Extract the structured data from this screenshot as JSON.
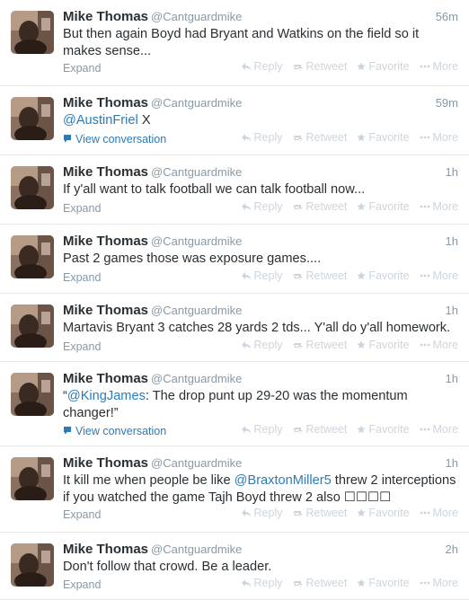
{
  "actions": {
    "reply": "Reply",
    "retweet": "Retweet",
    "favorite": "Favorite",
    "more": "More"
  },
  "colors": {
    "link": "#2b7bb9",
    "meta": "#8899a6",
    "action": "#cdd5dc"
  },
  "tweets": [
    {
      "name": "Mike Thomas",
      "handle": "@Cantguardmike",
      "time": "56m",
      "parts": [
        {
          "t": "But then again Boyd had Bryant and Watkins on the field so it makes sense..."
        }
      ],
      "footer": "Expand"
    },
    {
      "name": "Mike Thomas",
      "handle": "@Cantguardmike",
      "time": "59m",
      "parts": [
        {
          "t": "@AustinFriel",
          "m": true
        },
        {
          "t": " X"
        }
      ],
      "footer": "View conversation",
      "footer_link": true
    },
    {
      "name": "Mike Thomas",
      "handle": "@Cantguardmike",
      "time": "1h",
      "parts": [
        {
          "t": "If y'all want to talk football we can talk football now..."
        }
      ],
      "footer": "Expand"
    },
    {
      "name": "Mike Thomas",
      "handle": "@Cantguardmike",
      "time": "1h",
      "parts": [
        {
          "t": "Past 2 games those was exposure games...."
        }
      ],
      "footer": "Expand"
    },
    {
      "name": "Mike Thomas",
      "handle": "@Cantguardmike",
      "time": "1h",
      "parts": [
        {
          "t": "Martavis Bryant 3 catches 28 yards 2 tds... Y'all do y'all homework."
        }
      ],
      "footer": "Expand"
    },
    {
      "name": "Mike Thomas",
      "handle": "@Cantguardmike",
      "time": "1h",
      "parts": [
        {
          "t": "“"
        },
        {
          "t": "@KingJames",
          "m": true
        },
        {
          "t": ": The drop punt up 29-20 was the momentum changer!”"
        }
      ],
      "footer": "View conversation",
      "footer_link": true
    },
    {
      "name": "Mike Thomas",
      "handle": "@Cantguardmike",
      "time": "1h",
      "parts": [
        {
          "t": "It kill me when people be like "
        },
        {
          "t": "@BraxtonMiller5",
          "m": true
        },
        {
          "t": " threw 2 interceptions if you watched the game Tajh Boyd threw 2 also ☐☐☐☐"
        }
      ],
      "footer": "Expand"
    },
    {
      "name": "Mike Thomas",
      "handle": "@Cantguardmike",
      "time": "2h",
      "parts": [
        {
          "t": "Don't follow that crowd. Be a leader."
        }
      ],
      "footer": "Expand"
    }
  ]
}
